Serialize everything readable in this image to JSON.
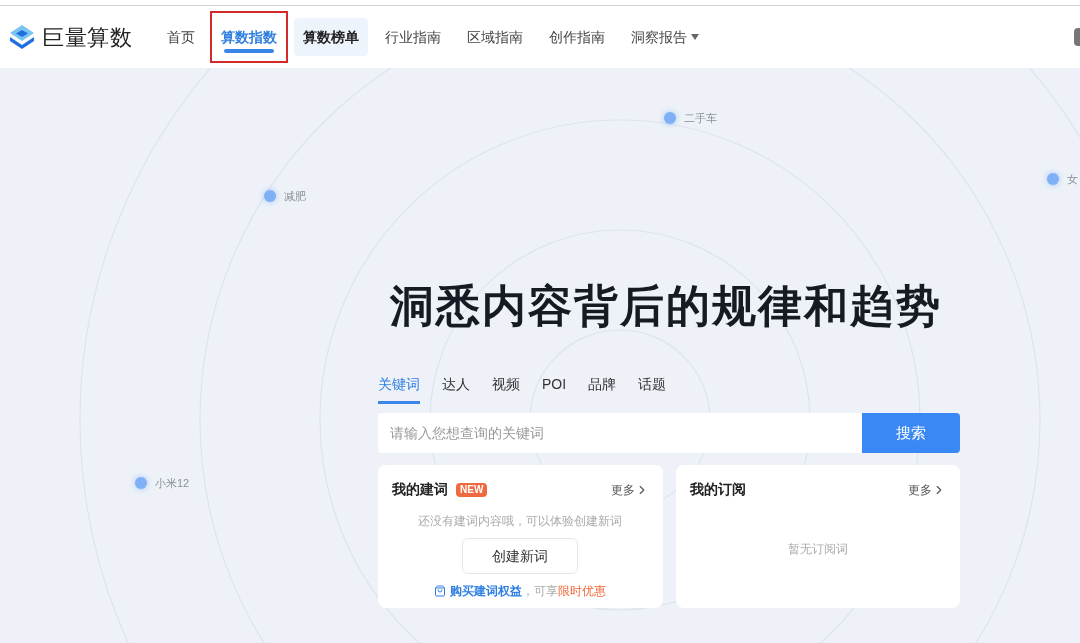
{
  "brand": {
    "name": "巨量算数"
  },
  "nav": [
    {
      "label": "首页",
      "selected": false,
      "hovered": false,
      "annotated": false,
      "dropdown": false
    },
    {
      "label": "算数指数",
      "selected": true,
      "hovered": false,
      "annotated": true,
      "dropdown": false
    },
    {
      "label": "算数榜单",
      "selected": false,
      "hovered": true,
      "annotated": false,
      "dropdown": false
    },
    {
      "label": "行业指南",
      "selected": false,
      "hovered": false,
      "annotated": false,
      "dropdown": false
    },
    {
      "label": "区域指南",
      "selected": false,
      "hovered": false,
      "annotated": false,
      "dropdown": false
    },
    {
      "label": "创作指南",
      "selected": false,
      "hovered": false,
      "annotated": false,
      "dropdown": false
    },
    {
      "label": "洞察报告",
      "selected": false,
      "hovered": false,
      "annotated": false,
      "dropdown": true
    }
  ],
  "keyword_bubbles": [
    "二手车",
    "减肥",
    "小米12",
    "女"
  ],
  "headline": "洞悉内容背后的规律和趋势",
  "search_tabs": [
    {
      "label": "关键词",
      "selected": true
    },
    {
      "label": "达人",
      "selected": false
    },
    {
      "label": "视频",
      "selected": false
    },
    {
      "label": "POI",
      "selected": false
    },
    {
      "label": "品牌",
      "selected": false
    },
    {
      "label": "话题",
      "selected": false
    }
  ],
  "search": {
    "placeholder": "请输入您想查询的关键词",
    "button": "搜索"
  },
  "cards": [
    {
      "title": "我的建词",
      "badge": "NEW",
      "more": "更多",
      "empty_text": "还没有建词内容哦，可以体验创建新词",
      "action": "创建新词",
      "promo": {
        "link": "购买建词权益",
        "middle": "，可享",
        "highlight": "限时优惠"
      }
    },
    {
      "title": "我的订阅",
      "more": "更多",
      "empty_text": "暂无订阅词"
    }
  ]
}
